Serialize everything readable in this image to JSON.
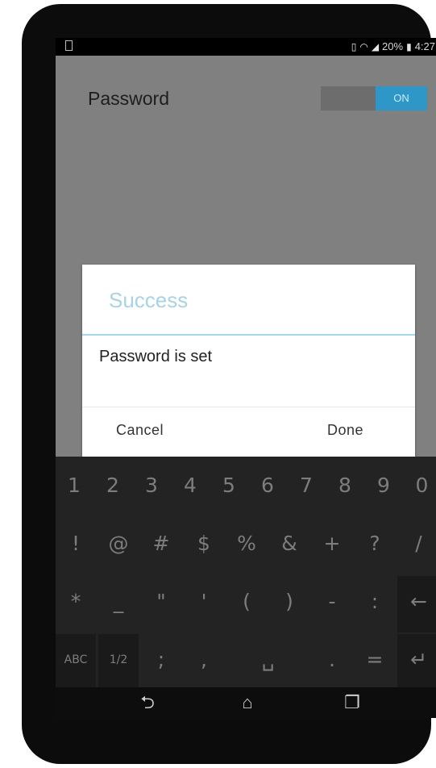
{
  "status_bar": {
    "battery": "20%",
    "time": "4:27"
  },
  "settings": {
    "password_label": "Password",
    "toggle_state": "ON"
  },
  "dialog": {
    "title": "Success",
    "message": "Password is set",
    "cancel_label": "Cancel",
    "done_label": "Done"
  },
  "keyboard": {
    "row1": [
      "1",
      "2",
      "3",
      "4",
      "5",
      "6",
      "7",
      "8",
      "9",
      "0"
    ],
    "row2": [
      "!",
      "@",
      "#",
      "$",
      "%",
      "&",
      "+",
      "?",
      "/"
    ],
    "row3": [
      "*",
      "_",
      "\"",
      "'",
      "(",
      ")",
      "-",
      ":",
      "←"
    ],
    "row4": [
      "ABC",
      "1/2",
      ";",
      ",",
      "␣",
      ".",
      "=",
      "↵"
    ]
  },
  "navbar": {
    "back_icon": "back-icon",
    "home_icon": "home-icon",
    "recents_icon": "recents-icon"
  },
  "colors": {
    "accent": "#2f97c7",
    "dialog_title": "#a8d3e6"
  }
}
